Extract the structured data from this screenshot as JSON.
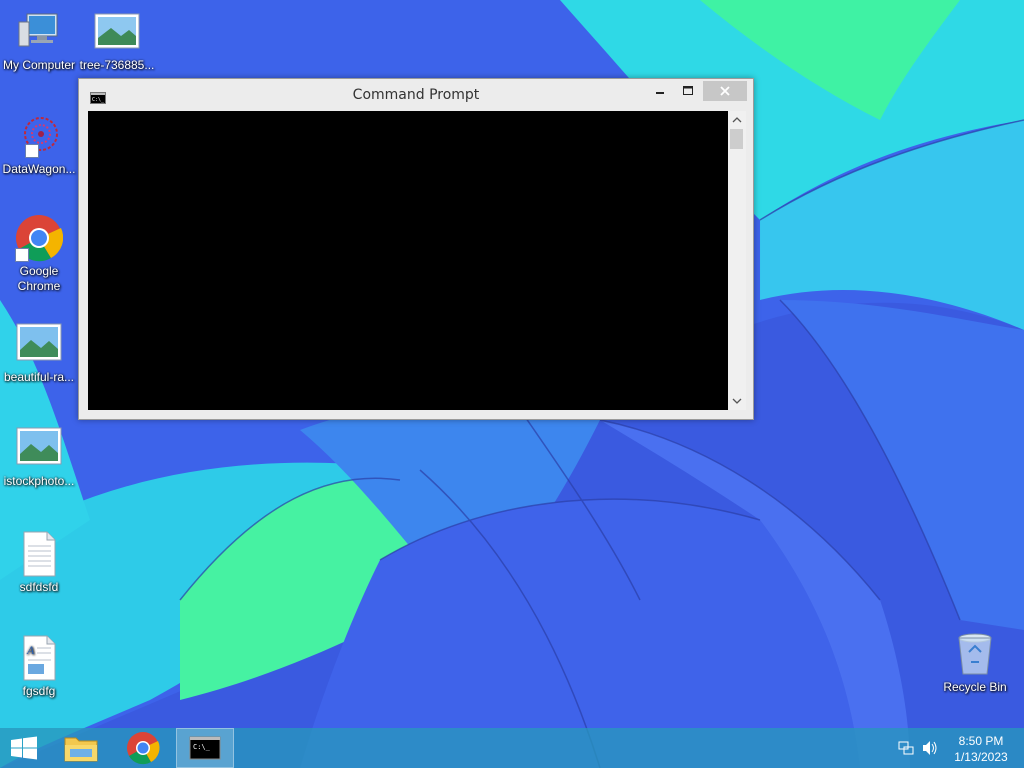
{
  "desktop": {
    "icons": [
      {
        "label": "My Computer"
      },
      {
        "label": "tree-736885..."
      },
      {
        "label": "DataWagon..."
      },
      {
        "label": "Google Chrome"
      },
      {
        "label": "beautiful-ra..."
      },
      {
        "label": "istockphoto..."
      },
      {
        "label": "sdfdsfd"
      },
      {
        "label": "fgsdfg"
      },
      {
        "label": "Recycle Bin"
      }
    ]
  },
  "window": {
    "title": "Command Prompt",
    "icon": "cmd-icon",
    "controls": [
      "minimize-icon",
      "maximize-icon",
      "close-icon"
    ]
  },
  "taskbar": {
    "items": [
      "start-icon",
      "file-explorer-icon",
      "chrome-icon",
      "cmd-icon"
    ],
    "tray": [
      "network-icon",
      "volume-icon"
    ],
    "time": "8:50 PM",
    "date": "1/13/2023"
  },
  "colors": {
    "console_bg": "#000000",
    "taskbar": "#2896be",
    "wallpaper_blue": "#3f5fe6",
    "wallpaper_cyan": "#2ed8e8",
    "wallpaper_green": "#3ef2a8"
  }
}
